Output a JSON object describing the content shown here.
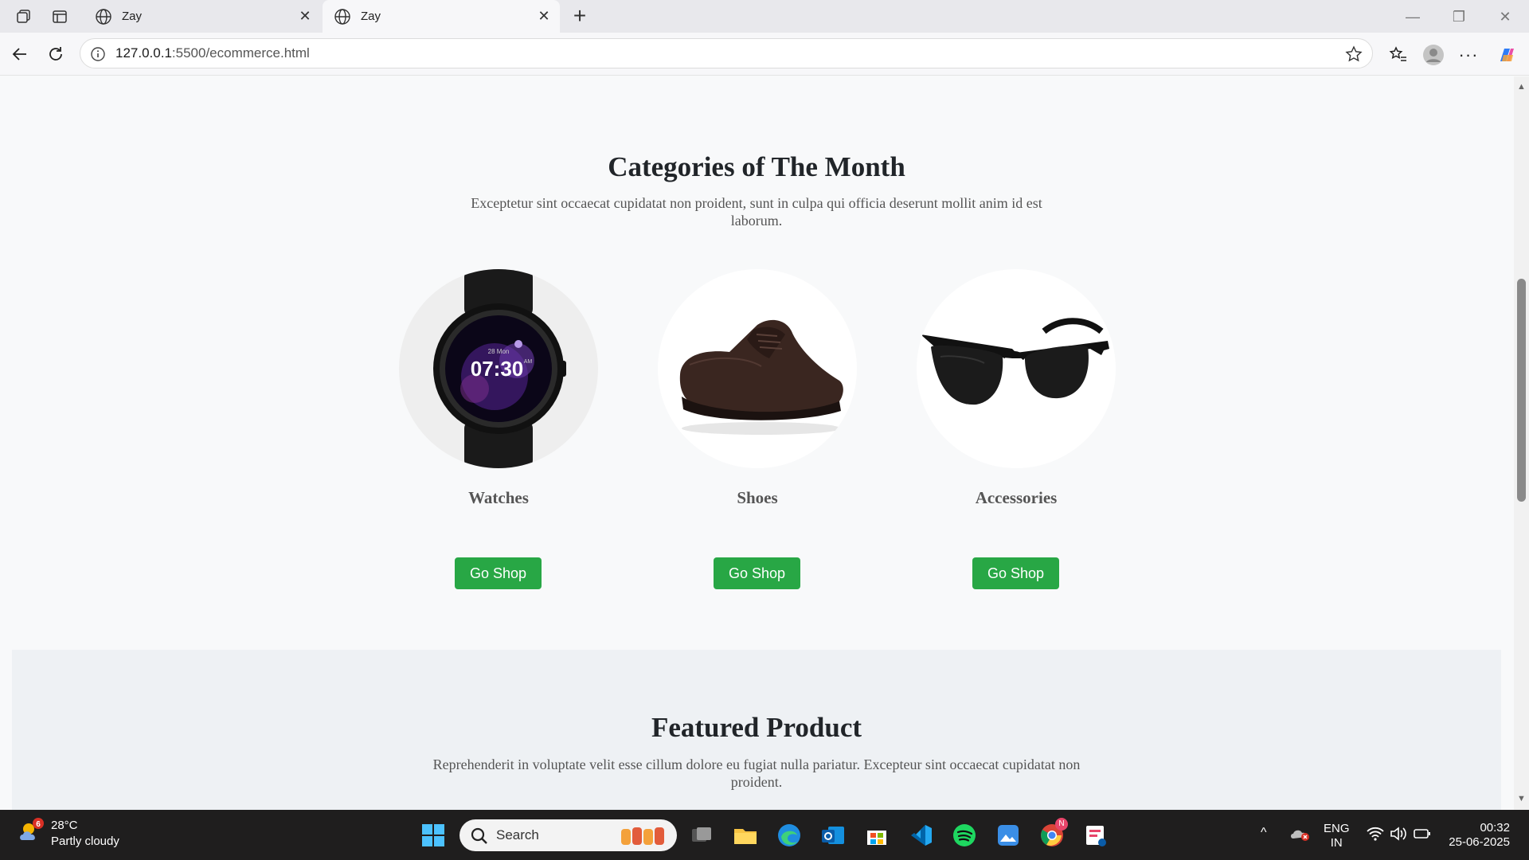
{
  "browser": {
    "tabs": [
      {
        "title": "Zay",
        "active": false
      },
      {
        "title": "Zay",
        "active": true
      }
    ],
    "url_host": "127.0.0.1",
    "url_path": ":5500/ecommerce.html"
  },
  "categories": {
    "title": "Categories of The Month",
    "description": "Exceptetur sint occaecat cupidatat non proident, sunt in culpa qui officia deserunt mollit anim id est laborum.",
    "items": [
      {
        "name": "Watches",
        "button": "Go Shop",
        "watch_date": "28 Mon",
        "watch_time": "07:30",
        "watch_ampm": "AM"
      },
      {
        "name": "Shoes",
        "button": "Go Shop"
      },
      {
        "name": "Accessories",
        "button": "Go Shop"
      }
    ]
  },
  "featured": {
    "title": "Featured Product",
    "description": "Reprehenderit in voluptate velit esse cillum dolore eu fugiat nulla pariatur. Excepteur sint occaecat cupidatat non proident."
  },
  "taskbar": {
    "weather_badge": "6",
    "weather_temp": "28°C",
    "weather_desc": "Partly cloudy",
    "search_label": "Search",
    "lang_line1": "ENG",
    "lang_line2": "IN",
    "time": "00:32",
    "date": "25-06-2025",
    "chrome_badge": "N"
  },
  "colors": {
    "accent_green": "#28a745",
    "page_bg": "#f8f9fa",
    "featured_bg": "#eef1f4",
    "taskbar_bg": "#1f1e1e"
  }
}
